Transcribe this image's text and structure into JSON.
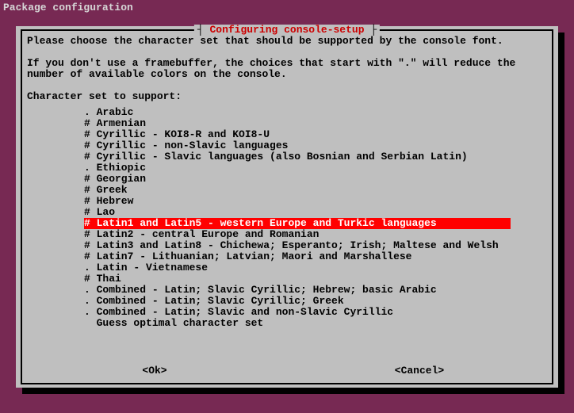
{
  "header": "Package configuration",
  "dialog": {
    "title": "Configuring console-setup",
    "text1": "Please choose the character set that should be supported by the console font.",
    "text2": "If you don't use a framebuffer, the choices that start with \".\" will reduce the number of available colors on the console.",
    "prompt": "Character set to support:",
    "items": [
      {
        "marker": ".",
        "label": "Arabic"
      },
      {
        "marker": "#",
        "label": "Armenian"
      },
      {
        "marker": "#",
        "label": "Cyrillic - KOI8-R and KOI8-U"
      },
      {
        "marker": "#",
        "label": "Cyrillic - non-Slavic languages"
      },
      {
        "marker": "#",
        "label": "Cyrillic - Slavic languages (also Bosnian and Serbian Latin)"
      },
      {
        "marker": ".",
        "label": "Ethiopic"
      },
      {
        "marker": "#",
        "label": "Georgian"
      },
      {
        "marker": "#",
        "label": "Greek"
      },
      {
        "marker": "#",
        "label": "Hebrew"
      },
      {
        "marker": "#",
        "label": "Lao"
      },
      {
        "marker": "#",
        "label": "Latin1 and Latin5 - western Europe and Turkic languages",
        "selected": true
      },
      {
        "marker": "#",
        "label": "Latin2 - central Europe and Romanian"
      },
      {
        "marker": "#",
        "label": "Latin3 and Latin8 - Chichewa; Esperanto; Irish; Maltese and Welsh"
      },
      {
        "marker": "#",
        "label": "Latin7 - Lithuanian; Latvian; Maori and Marshallese"
      },
      {
        "marker": ".",
        "label": "Latin - Vietnamese"
      },
      {
        "marker": "#",
        "label": "Thai"
      },
      {
        "marker": ".",
        "label": "Combined - Latin; Slavic Cyrillic; Hebrew; basic Arabic"
      },
      {
        "marker": ".",
        "label": "Combined - Latin; Slavic Cyrillic; Greek"
      },
      {
        "marker": ".",
        "label": "Combined - Latin; Slavic and non-Slavic Cyrillic"
      },
      {
        "marker": " ",
        "label": "Guess optimal character set"
      }
    ],
    "ok": "<Ok>",
    "cancel": "<Cancel>"
  }
}
